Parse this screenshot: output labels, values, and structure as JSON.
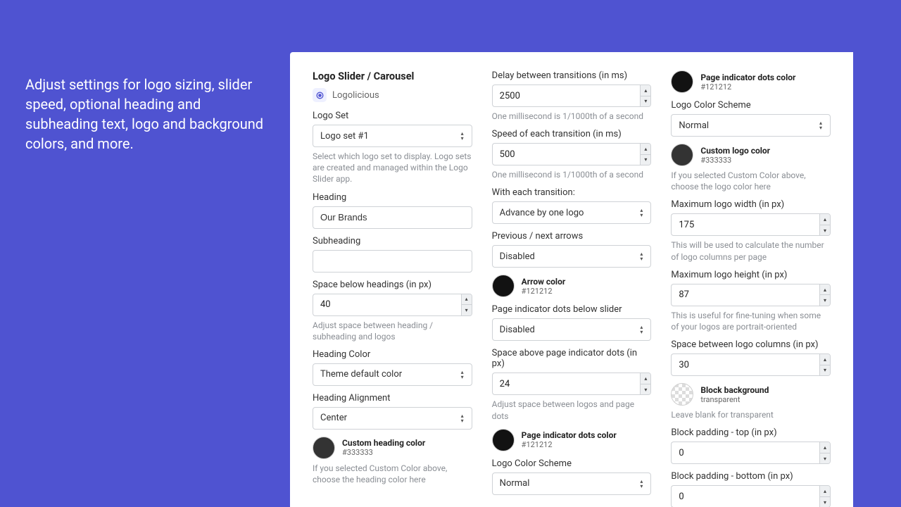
{
  "marketing": "Adjust settings for logo sizing, slider speed, optional heading and subheading text, logo and background colors, and more.",
  "section_title": "Logo Slider / Carousel",
  "app_name": "Logolicious",
  "col1": {
    "logo_set": {
      "label": "Logo Set",
      "value": "Logo set #1",
      "help": "Select which logo set to display. Logo sets are created and managed within the Logo Slider app."
    },
    "heading": {
      "label": "Heading",
      "value": "Our Brands"
    },
    "subheading": {
      "label": "Subheading",
      "value": ""
    },
    "space_below": {
      "label": "Space below headings (in px)",
      "value": "40",
      "help": "Adjust space between heading / subheading and logos"
    },
    "heading_color": {
      "label": "Heading Color",
      "value": "Theme default color"
    },
    "heading_align": {
      "label": "Heading Alignment",
      "value": "Center"
    },
    "custom_heading_color": {
      "name": "Custom heading color",
      "value": "#333333",
      "swatch": "#333333",
      "help": "If you selected Custom Color above, choose the heading color here"
    }
  },
  "col2": {
    "delay": {
      "label": "Delay between transitions (in ms)",
      "value": "2500",
      "help": "One millisecond is 1/1000th of a second"
    },
    "speed": {
      "label": "Speed of each transition (in ms)",
      "value": "500",
      "help": "One millisecond is 1/1000th of a second"
    },
    "each": {
      "label": "With each transition:",
      "value": "Advance by one logo"
    },
    "arrows": {
      "label": "Previous / next arrows",
      "value": "Disabled"
    },
    "arrow_color": {
      "name": "Arrow color",
      "value": "#121212",
      "swatch": "#121212"
    },
    "dots": {
      "label": "Page indicator dots below slider",
      "value": "Disabled"
    },
    "dots_space": {
      "label": "Space above page indicator dots (in px)",
      "value": "24",
      "help": "Adjust space between logos and page dots"
    },
    "dots_color": {
      "name": "Page indicator dots color",
      "value": "#121212",
      "swatch": "#121212"
    },
    "scheme": {
      "label": "Logo Color Scheme",
      "value": "Normal"
    }
  },
  "col3": {
    "dots_color": {
      "name": "Page indicator dots color",
      "value": "#121212",
      "swatch": "#121212"
    },
    "scheme": {
      "label": "Logo Color Scheme",
      "value": "Normal"
    },
    "custom_logo_color": {
      "name": "Custom logo color",
      "value": "#333333",
      "swatch": "#333333",
      "help": "If you selected Custom Color above, choose the logo color here"
    },
    "max_w": {
      "label": "Maximum logo width (in px)",
      "value": "175",
      "help": "This will be used to calculate the number of logo columns per page"
    },
    "max_h": {
      "label": "Maximum logo height (in px)",
      "value": "87",
      "help": "This is useful for fine-tuning when some of your logos are portrait-oriented"
    },
    "col_space": {
      "label": "Space between logo columns (in px)",
      "value": "30"
    },
    "block_bg": {
      "name": "Block background",
      "value": "transparent",
      "help": "Leave blank for transparent"
    },
    "pad_top": {
      "label": "Block padding - top (in px)",
      "value": "0"
    },
    "pad_bottom": {
      "label": "Block padding - bottom (in px)",
      "value": "0"
    }
  }
}
